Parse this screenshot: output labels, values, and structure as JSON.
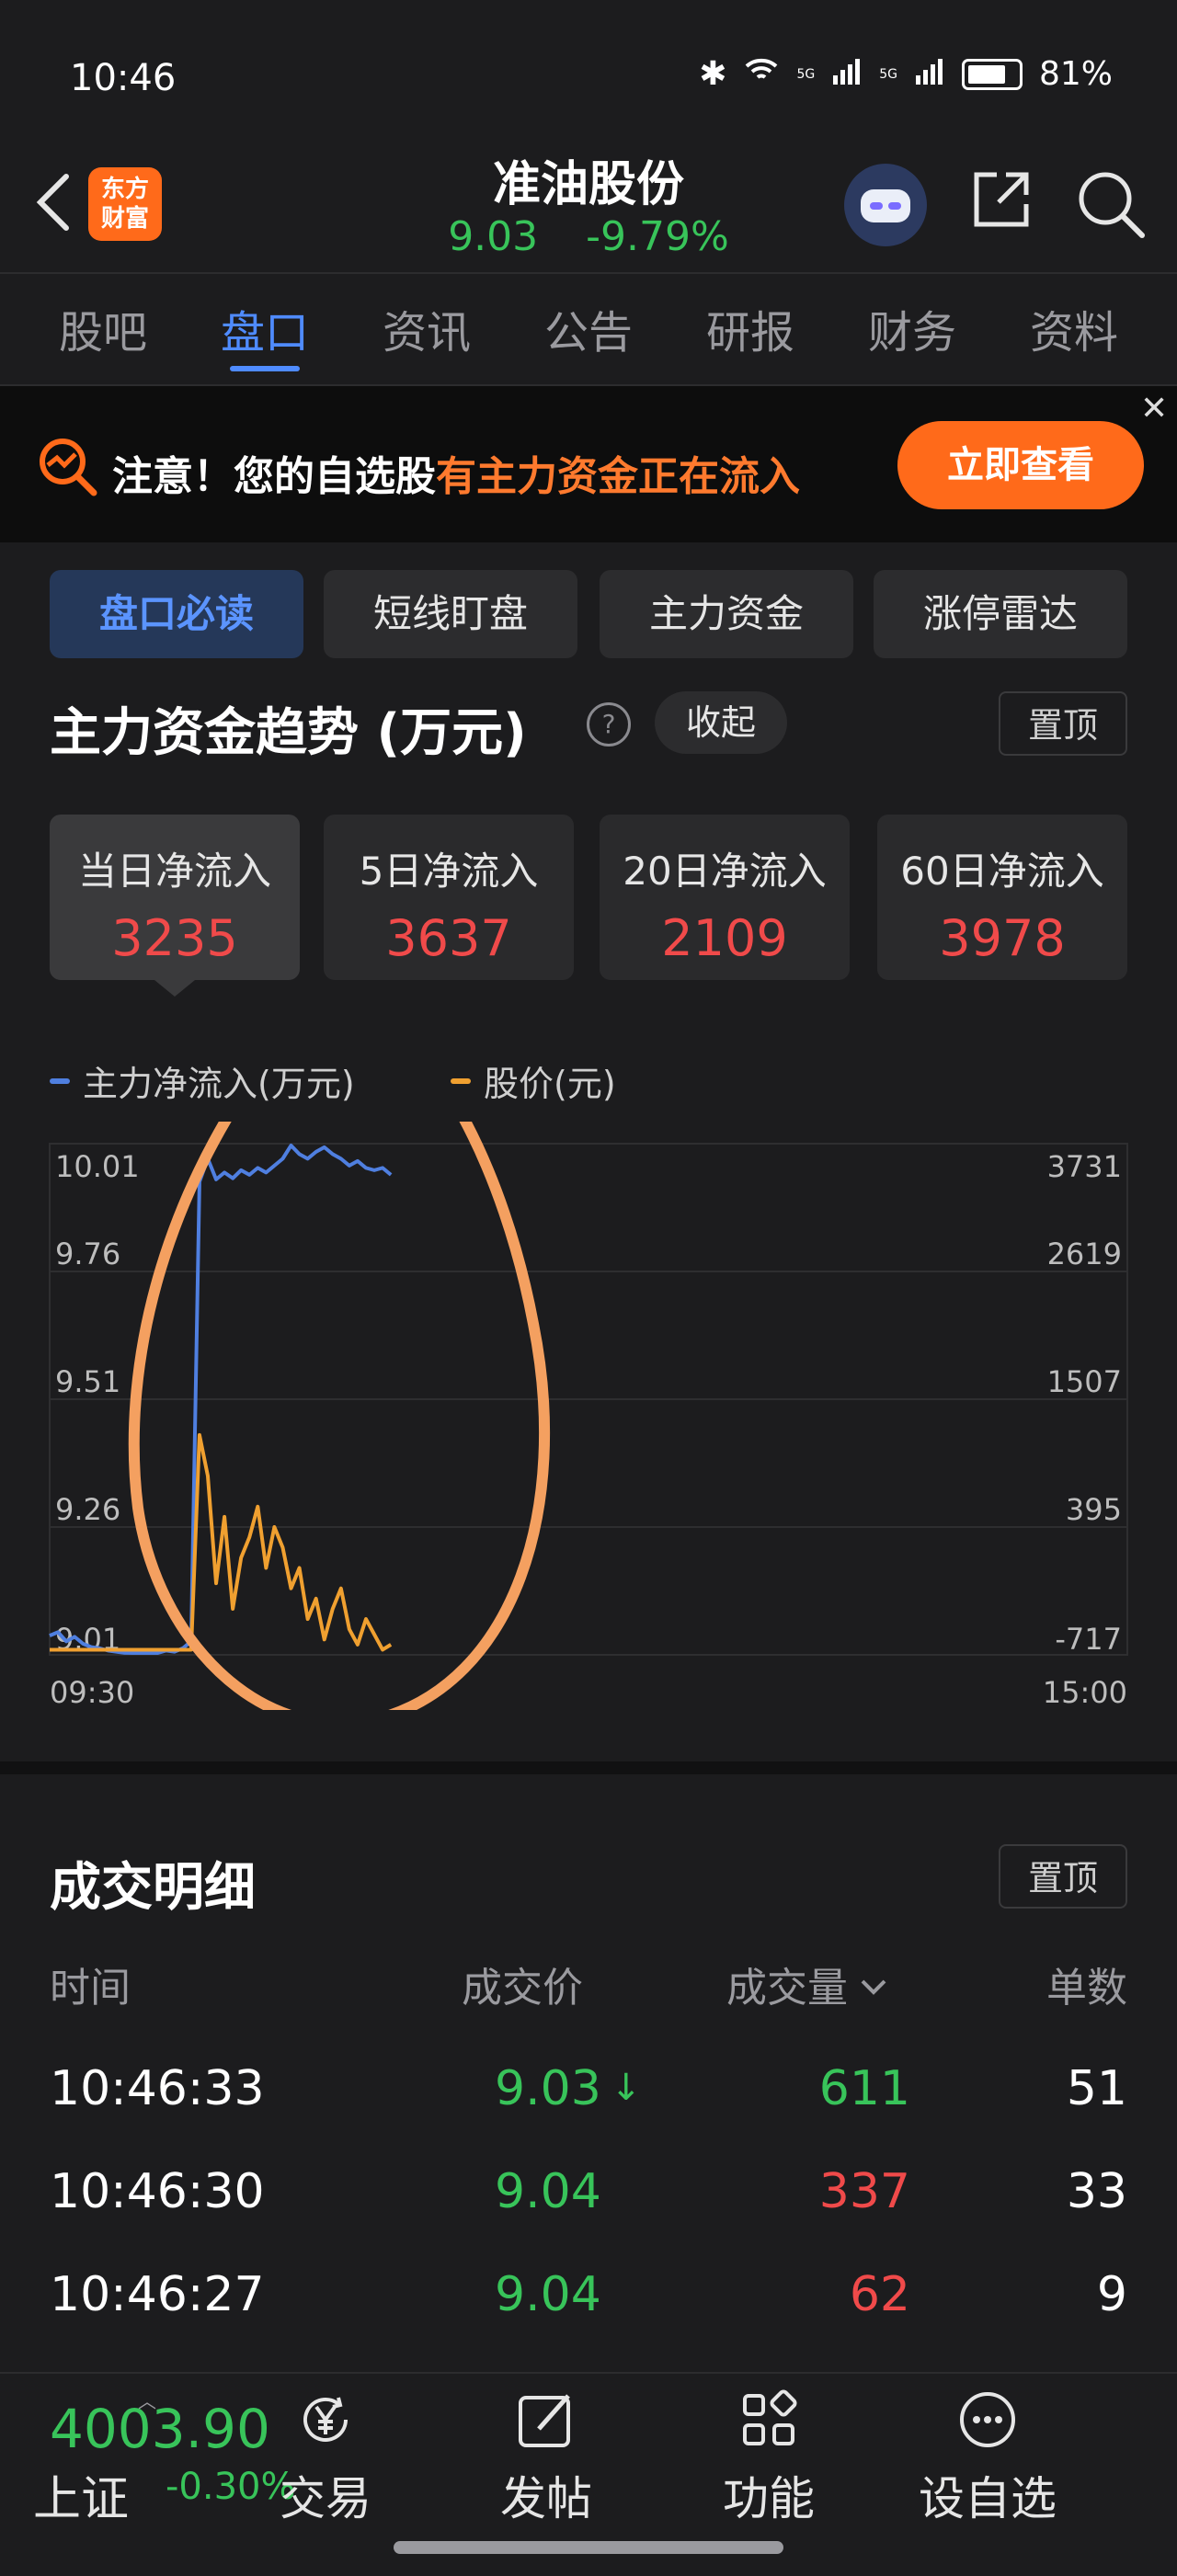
{
  "status_bar": {
    "time": "10:46",
    "battery": "81%",
    "net1": "5G",
    "net2": "5G"
  },
  "header": {
    "logo_line1": "东方",
    "logo_line2": "财富",
    "stock_name": "准油股份",
    "price": "9.03",
    "change": "-9.79%"
  },
  "tabs": [
    "股吧",
    "盘口",
    "资讯",
    "公告",
    "研报",
    "财务",
    "资料"
  ],
  "active_tab": "盘口",
  "banner": {
    "prefix": "注意！您的自选股",
    "highlight": "有主力资金正在流入",
    "button": "立即查看",
    "close": "✕"
  },
  "subtabs": [
    "盘口必读",
    "短线盯盘",
    "主力资金",
    "涨停雷达"
  ],
  "fund_section": {
    "title": "主力资金趋势 (万元)",
    "help": "?",
    "collapse": "收起",
    "pin": "置顶",
    "cards": [
      {
        "label": "当日净流入",
        "value": "3235"
      },
      {
        "label": "5日净流入",
        "value": "3637"
      },
      {
        "label": "20日净流入",
        "value": "2109"
      },
      {
        "label": "60日净流入",
        "value": "3978"
      }
    ]
  },
  "chart_data": {
    "type": "line",
    "legend_position": "top-left",
    "grid": true,
    "x_start": "09:30",
    "x_end": "15:00",
    "left_axis": {
      "ticks": [
        "10.01",
        "9.76",
        "9.51",
        "9.26",
        "9.01"
      ],
      "range": [
        9.01,
        10.01
      ]
    },
    "right_axis": {
      "ticks": [
        "3731",
        "2619",
        "1507",
        "395",
        "-717"
      ],
      "range": [
        -717,
        3731
      ]
    },
    "series": [
      {
        "name": "主力净流入(万元)",
        "color": "#4f7fe0",
        "axis": "right",
        "values": [
          -550,
          -520,
          -600,
          -560,
          -620,
          -650,
          -660,
          -680,
          -690,
          -700,
          -705,
          -710,
          -700,
          -705,
          -680,
          -690,
          -660,
          -600,
          3400,
          3600,
          3420,
          3480,
          3430,
          3500,
          3460,
          3520,
          3480,
          3540,
          3600,
          3720,
          3640,
          3600,
          3660,
          3700,
          3640,
          3600,
          3540,
          3580,
          3520,
          3500,
          3520,
          3460
        ]
      },
      {
        "name": "股价(元)",
        "color": "#f0a030",
        "axis": "left",
        "values": [
          9.02,
          9.02,
          9.02,
          9.02,
          9.02,
          9.02,
          9.02,
          9.02,
          9.02,
          9.02,
          9.02,
          9.02,
          9.02,
          9.02,
          9.02,
          9.02,
          9.02,
          9.02,
          9.44,
          9.36,
          9.15,
          9.28,
          9.1,
          9.2,
          9.24,
          9.3,
          9.18,
          9.26,
          9.22,
          9.14,
          9.18,
          9.08,
          9.12,
          9.04,
          9.1,
          9.14,
          9.06,
          9.03,
          9.08,
          9.05,
          9.02,
          9.03
        ]
      }
    ]
  },
  "trades": {
    "title": "成交明细",
    "pin": "置顶",
    "headers": {
      "time": "时间",
      "price": "成交价",
      "volume": "成交量",
      "count": "单数"
    },
    "rows": [
      {
        "time": "10:46:33",
        "price": "9.03",
        "arrow": "↓",
        "volume": "611",
        "volume_color": "green",
        "count": "51"
      },
      {
        "time": "10:46:30",
        "price": "9.04",
        "arrow": "",
        "volume": "337",
        "volume_color": "red",
        "count": "33"
      },
      {
        "time": "10:46:27",
        "price": "9.04",
        "arrow": "",
        "volume": "62",
        "volume_color": "red",
        "count": "9"
      }
    ]
  },
  "bottom_bar": {
    "index_value": "4003.90",
    "index_name": "上证",
    "index_change": "-0.30%",
    "nav": [
      {
        "label": "交易",
        "icon": "yen-icon"
      },
      {
        "label": "发帖",
        "icon": "compose-icon"
      },
      {
        "label": "功能",
        "icon": "grid-icon"
      },
      {
        "label": "设自选",
        "icon": "more-icon"
      }
    ]
  }
}
